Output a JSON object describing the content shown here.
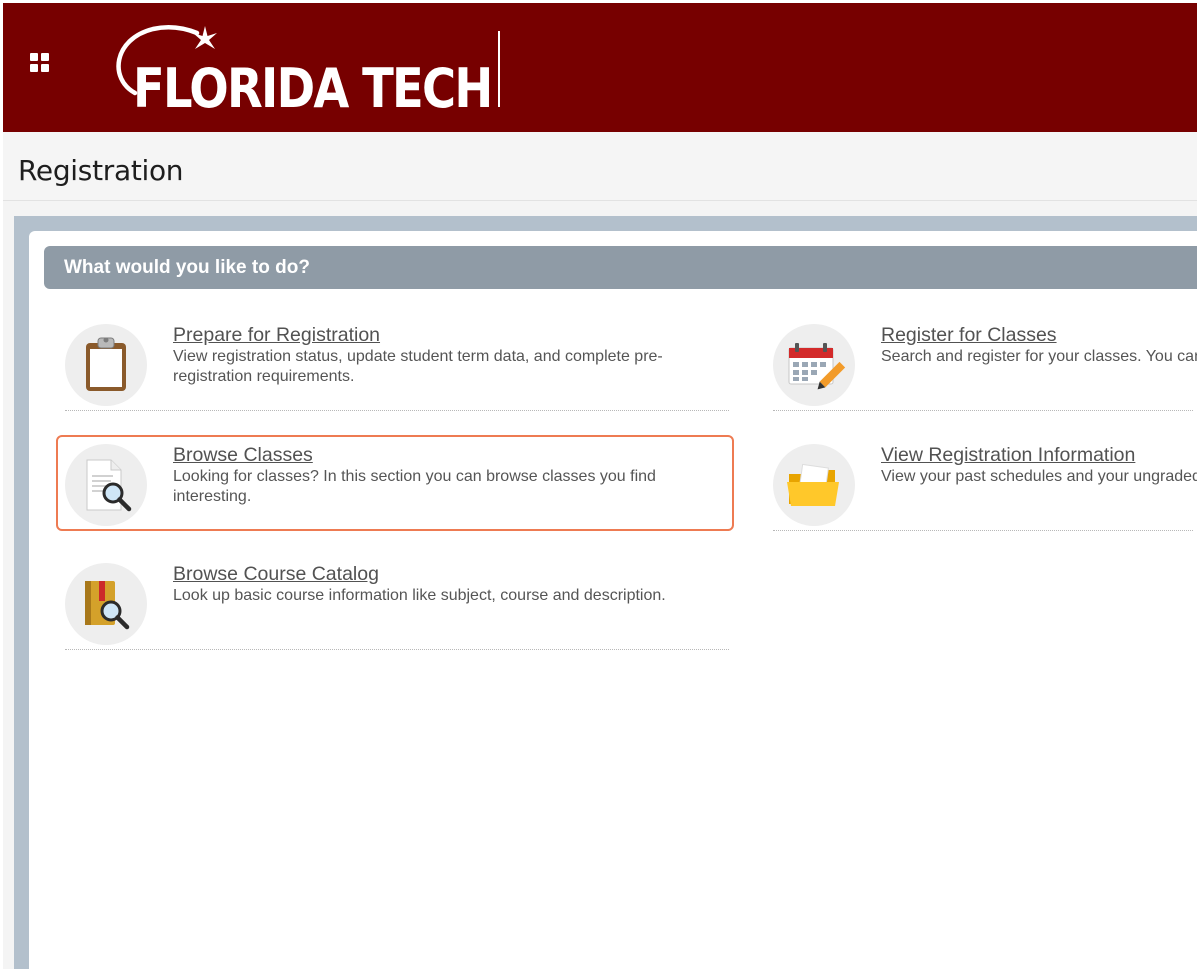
{
  "header": {
    "brand": "FLORIDA TECH",
    "brand_color": "#770000"
  },
  "page": {
    "title": "Registration"
  },
  "section": {
    "heading": "What would you like to do?"
  },
  "actions": [
    {
      "title": "Prepare for Registration",
      "description": "View registration status, update student term data, and complete pre-registration requirements.",
      "icon": "clipboard-icon"
    },
    {
      "title": "Register for Classes",
      "description": "Search and register for your classes. You can also view and manage your schedule.",
      "icon": "calendar-icon"
    },
    {
      "title": "Browse Classes",
      "description": "Looking for classes? In this section you can browse classes you find interesting.",
      "icon": "document-search-icon"
    },
    {
      "title": "View Registration Information",
      "description": "View your past schedules and your ungraded classes.",
      "icon": "folder-icon"
    },
    {
      "title": "Browse Course Catalog",
      "description": "Look up basic course information like subject, course and description.",
      "icon": "book-search-icon"
    }
  ],
  "highlight_color": "#ee7b52"
}
